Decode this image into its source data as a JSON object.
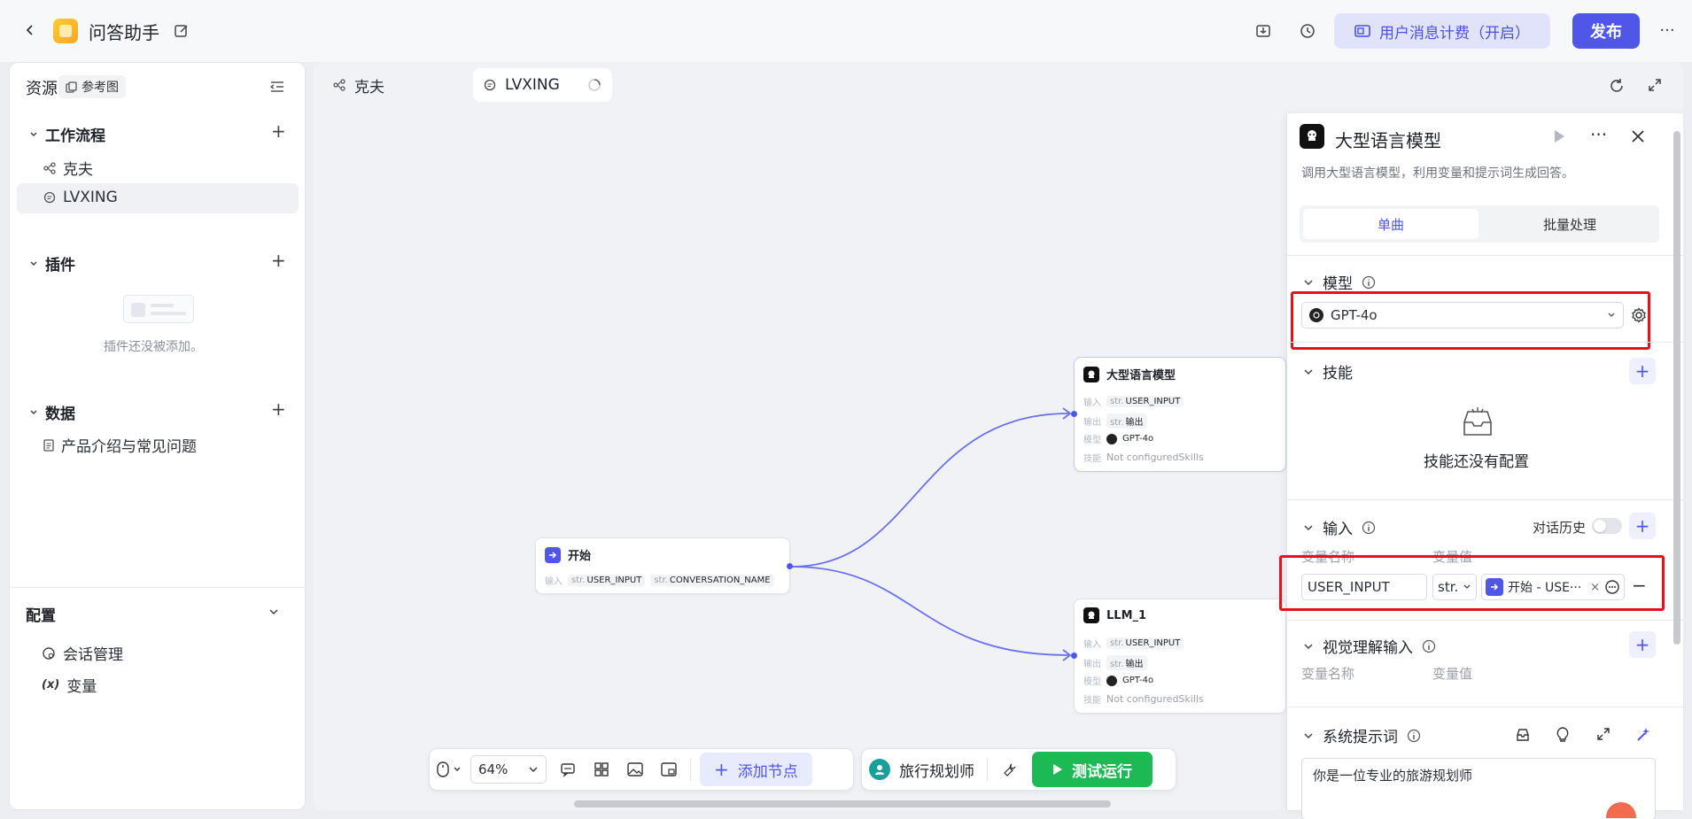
{
  "header": {
    "app_name": "问答助手",
    "billing_label": "用户消息计费（开启）",
    "publish_label": "发布"
  },
  "sidebar": {
    "title": "资源",
    "reference_label": "参考图",
    "workflow_title": "工作流程",
    "workflow_items": [
      "克夫",
      "LVXING"
    ],
    "plugins_title": "插件",
    "plugins_empty": "插件还没被添加。",
    "data_title": "数据",
    "data_items": [
      "产品介绍与常见问题"
    ],
    "config_title": "配置",
    "config_items": [
      "会话管理",
      "变量"
    ]
  },
  "canvas": {
    "tabs": [
      "克夫",
      "LVXING"
    ],
    "nodes": {
      "start": {
        "title": "开始",
        "input_label": "输入",
        "inputs": [
          {
            "type": "str.",
            "name": "USER_INPUT"
          },
          {
            "type": "str.",
            "name": "CONVERSATION_NAME"
          }
        ]
      },
      "llm": {
        "title": "大型语言模型",
        "input_label": "输入",
        "input_type": "str.",
        "input_value": "USER_INPUT",
        "output_label": "输出",
        "output_type": "str.",
        "output_value": "输出",
        "model_label": "模型",
        "model_value": "GPT-4o",
        "skills_label": "技能",
        "skills_value": "Not configuredSkills"
      },
      "llm1": {
        "title": "LLM_1",
        "input_label": "输入",
        "input_type": "str.",
        "input_value": "USER_INPUT",
        "output_label": "输出",
        "output_type": "str.",
        "output_value": "输出",
        "model_label": "模型",
        "model_value": "GPT-4o",
        "skills_label": "技能",
        "skills_value": "Not configuredSkills"
      }
    },
    "toolbar": {
      "zoom": "64%",
      "add_node_label": "添加节点",
      "agent_name": "旅行规划师",
      "test_run_label": "测试运行"
    }
  },
  "panel": {
    "title": "大型语言模型",
    "description": "调用大型语言模型，利用变量和提示词生成回答。",
    "tabs": [
      "单曲",
      "批量处理"
    ],
    "model_section": "模型",
    "model_value": "GPT-4o",
    "skills_section": "技能",
    "skills_empty": "技能还没有配置",
    "input_section": "输入",
    "chat_history_label": "对话历史",
    "col_name": "变量名称",
    "col_value": "变量值",
    "input_row": {
      "name": "USER_INPUT",
      "type": "str.",
      "ref": "开始 - USE···"
    },
    "vision_section": "视觉理解输入",
    "vision_col_name": "变量名称",
    "vision_col_value": "变量值",
    "system_prompt_section": "系统提示词",
    "system_prompt_text": "你是一位专业的旅游规划师"
  },
  "colors": {
    "accent": "#4f56e8",
    "run_green": "#1db954",
    "highlight_red": "#e5111b",
    "edge": "#6a70ea"
  }
}
